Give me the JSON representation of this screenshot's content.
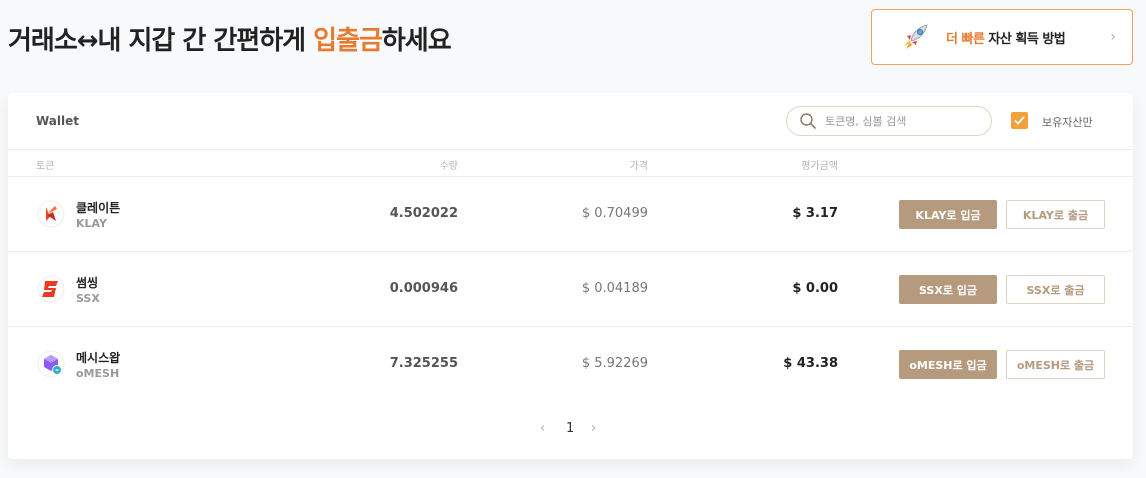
{
  "headline": {
    "part1": "거래소↔내 지갑 간 간편하게 ",
    "accent": "입출금",
    "part2": "하세요"
  },
  "promo": {
    "highlight": "더 빠른",
    "text": " 자산 획득 방법",
    "icon": "rocket-icon",
    "chevron": "›"
  },
  "wallet": {
    "title": "Wallet",
    "search_placeholder": "토큰명, 심볼 검색",
    "owned_only_label": "보유자산만",
    "owned_only_checked": true,
    "columns": {
      "token": "토큰",
      "quantity": "수량",
      "price": "가격",
      "value": "평가금액"
    },
    "tokens": [
      {
        "name": "클레이튼",
        "symbol": "KLAY",
        "quantity": "4.502022",
        "price": "$ 0.70499",
        "value": "$ 3.17",
        "deposit_label": "KLAY로 입금",
        "withdraw_label": "KLAY로 출금",
        "icon": "klaytn-icon"
      },
      {
        "name": "썸씽",
        "symbol": "SSX",
        "quantity": "0.000946",
        "price": "$ 0.04189",
        "value": "$ 0.00",
        "deposit_label": "SSX로 입금",
        "withdraw_label": "SSX로 출금",
        "icon": "ssx-icon"
      },
      {
        "name": "메시스왑",
        "symbol": "oMESH",
        "quantity": "7.325255",
        "price": "$ 5.92269",
        "value": "$ 43.38",
        "deposit_label": "oMESH로 입금",
        "withdraw_label": "oMESH로 출금",
        "icon": "meshswap-icon"
      }
    ],
    "pagination": {
      "prev": "‹",
      "current": "1",
      "next": "›"
    }
  },
  "colors": {
    "accent": "#e67a2e",
    "button": "#b59a7e",
    "checkbox": "#f3a23b"
  }
}
